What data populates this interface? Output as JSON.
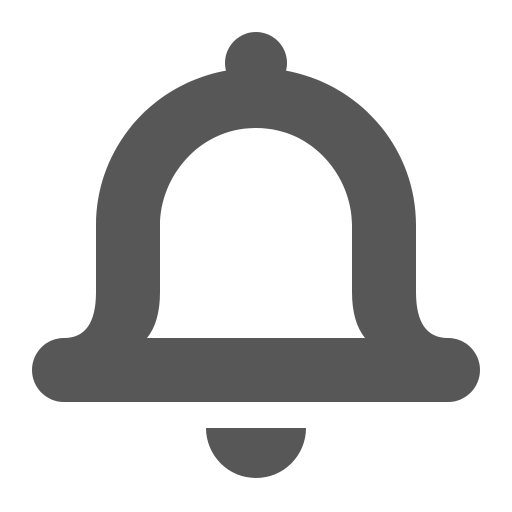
{
  "icon": {
    "name": "bell-icon",
    "meaning": "notifications",
    "color": "#575757",
    "background": "#ffffff"
  }
}
